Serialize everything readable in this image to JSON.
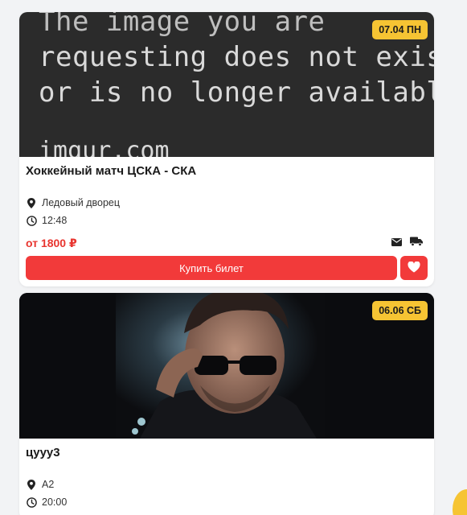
{
  "events": [
    {
      "image_text_lines": [
        "The image you are",
        "requesting does not exist",
        "or is no longer available."
      ],
      "image_text_domain": "imgur.com",
      "date_badge": "07.04 ПН",
      "title": "Хоккейный матч ЦСКА - СКА",
      "venue": "Ледовый дворец",
      "time": "12:48",
      "price": "от 1800 ₽",
      "buy_label": "Купить билет"
    },
    {
      "date_badge": "06.06 СБ",
      "title": "цууу3",
      "venue": "А2",
      "time": "20:00"
    }
  ],
  "icons": {
    "location": "map-pin-icon",
    "time": "clock-icon",
    "email": "envelope-icon",
    "delivery": "truck-icon",
    "favorite": "heart-icon"
  },
  "colors": {
    "accent": "#f23a3a",
    "price": "#e8352f",
    "badge": "#f6c433"
  }
}
